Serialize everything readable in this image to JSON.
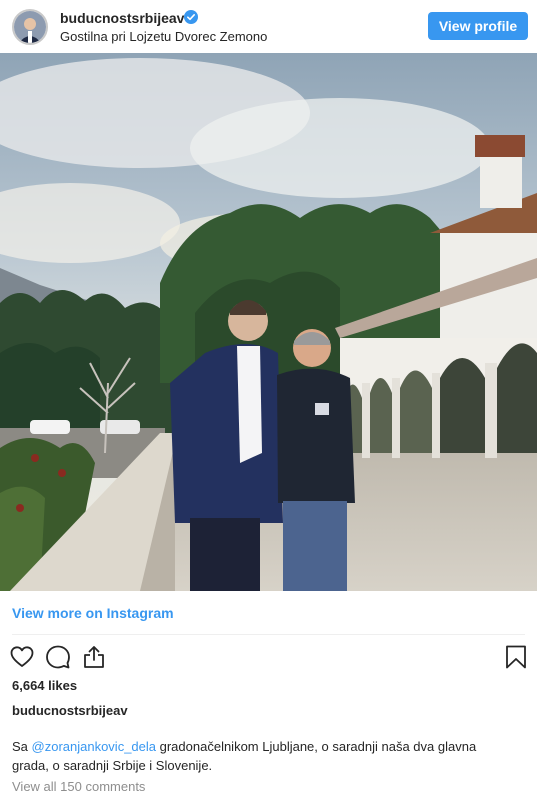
{
  "post": {
    "username": "buducnostsrbijeav",
    "verified": true,
    "location": "Gostilna pri Lojzetu Dvorec Zemono",
    "view_profile_label": "View profile",
    "view_more_label": "View more on Instagram",
    "likes": "6,664 likes",
    "caption_username": "buducnostsrbijeav",
    "caption_prefix": "Sa ",
    "caption_mention": "@zoranjankovic_dela",
    "caption_rest": " gradonačelnikom Ljubljane, o saradnji naša dva glavna grada, o saradnji Srbije i Slovenije.",
    "view_comments_label": "View all 150 comments"
  },
  "icons": {
    "like": "heart-icon",
    "comment": "comment-icon",
    "share": "share-icon",
    "save": "bookmark-icon",
    "verified": "verified-badge-icon"
  },
  "colors": {
    "accent": "#3897f0",
    "text": "#262626",
    "muted": "#8e8e8e"
  }
}
